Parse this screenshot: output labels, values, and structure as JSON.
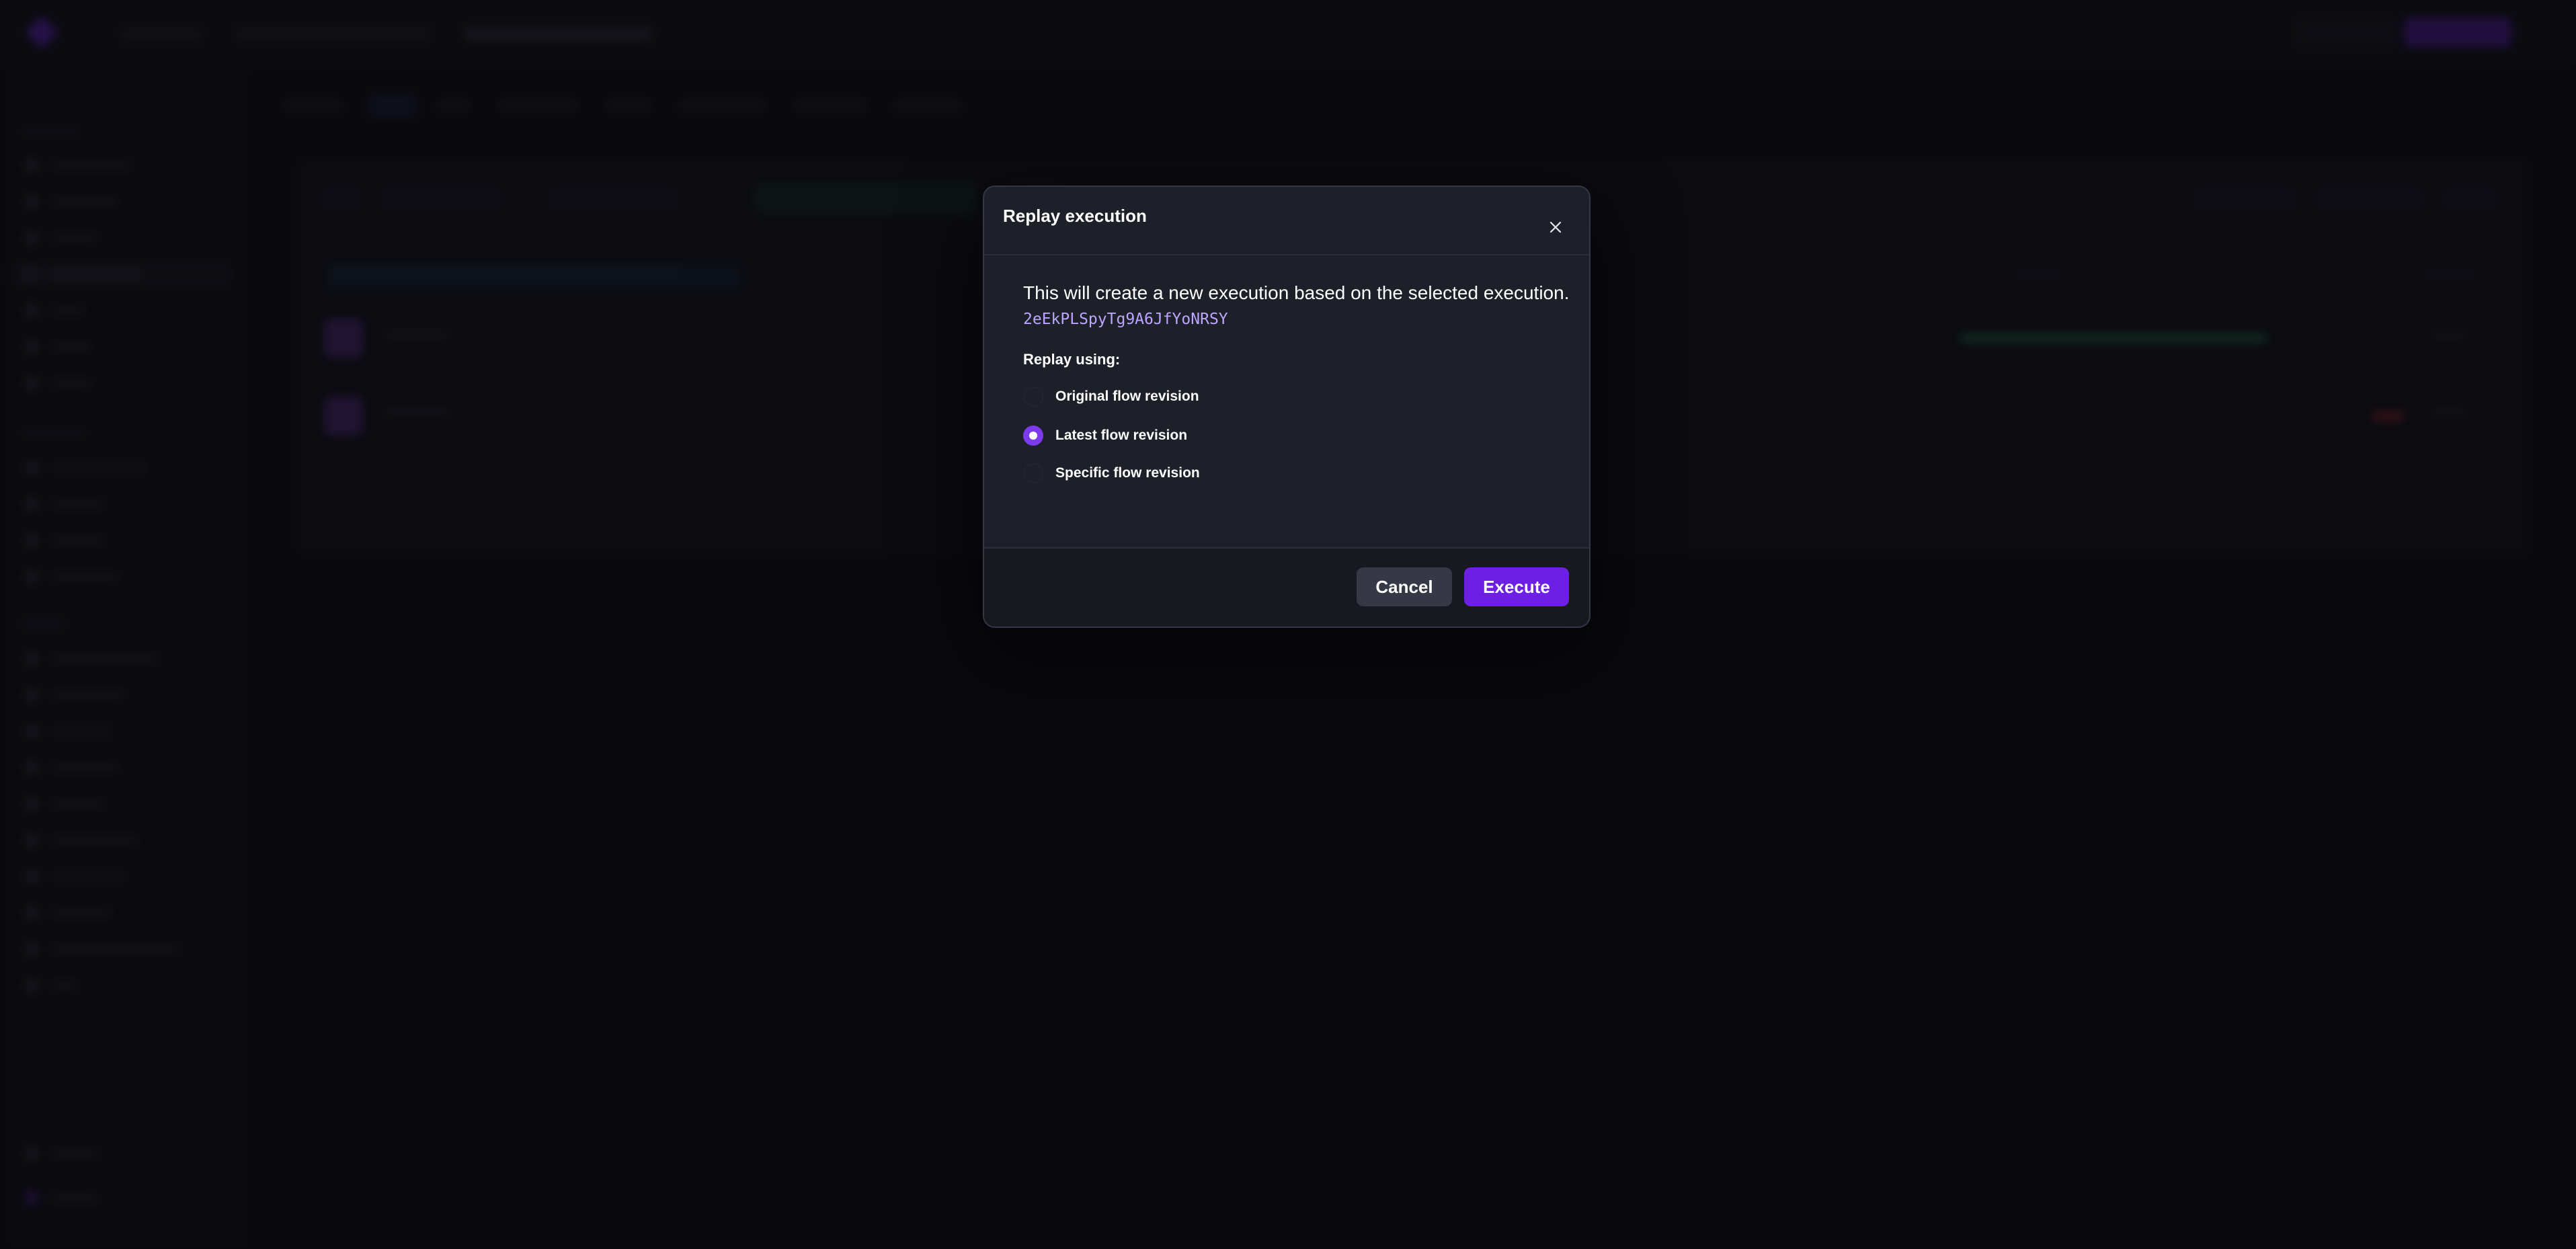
{
  "modal": {
    "title": "Replay execution",
    "description": "This will create a new execution based on the selected execution.",
    "execution_id": "2eEkPLSpyTg9A6JfYoNRSY",
    "replay_label": "Replay using:",
    "options": [
      {
        "label": "Original flow revision",
        "checked": false
      },
      {
        "label": "Latest flow revision",
        "checked": true
      },
      {
        "label": "Specific flow revision",
        "checked": false
      }
    ],
    "cancel_label": "Cancel",
    "execute_label": "Execute"
  },
  "colors": {
    "accent": "#6d1fe6",
    "execution_id": "#bca6ff",
    "modal_background": "#1e2029",
    "page_background": "#0f0f14"
  },
  "icons": {
    "close": "close-icon"
  }
}
